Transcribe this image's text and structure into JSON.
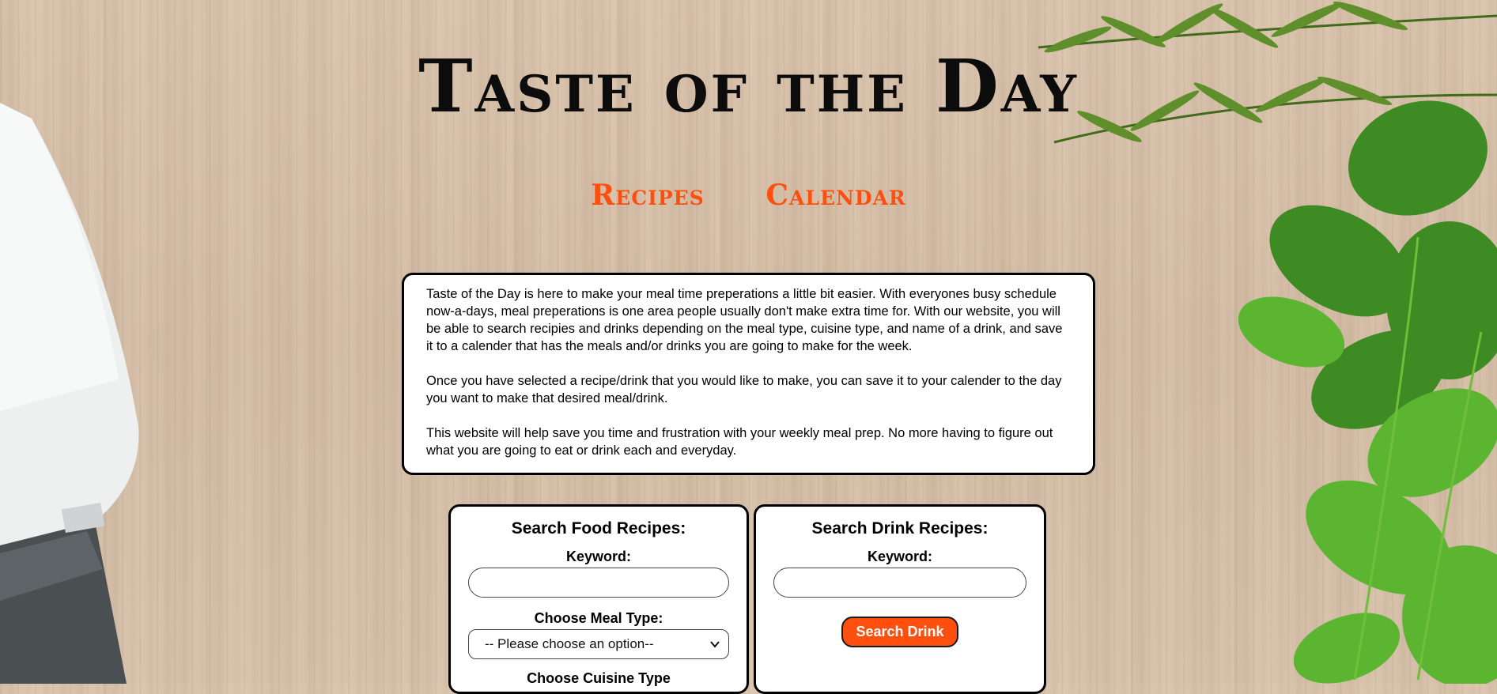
{
  "header": {
    "title": "Taste of the Day"
  },
  "nav": {
    "items": [
      {
        "label": "Recipes"
      },
      {
        "label": "Calendar"
      }
    ]
  },
  "intro": {
    "paragraphs": [
      "Taste of the Day is here to make your meal time preperations a little bit easier. With everyones busy schedule now-a-days, meal preperations is one area people usually don't make extra time for. With our website, you will be able to search recipies and drinks depending on the meal type, cuisine type, and name of a drink, and save it to a calender that has the meals and/or drinks you are going to make for the week.",
      "Once you have selected a recipe/drink that you would like to make, you can save it to your calender to the day you want to make that desired meal/drink.",
      "This website will help save you time and frustration with your weekly meal prep. No more having to figure out what you are going to eat or drink each and everyday."
    ]
  },
  "food_search": {
    "title": "Search Food Recipes:",
    "keyword_label": "Keyword:",
    "keyword_value": "",
    "meal_type_label": "Choose Meal Type:",
    "meal_type_selected": "-- Please choose an option--",
    "cuisine_label_partial": "Choose Cuisine Type"
  },
  "drink_search": {
    "title": "Search Drink Recipes:",
    "keyword_label": "Keyword:",
    "keyword_value": "",
    "button_label": "Search Drink"
  },
  "colors": {
    "accent": "#ff4f0f",
    "text": "#000000",
    "card_bg": "#ffffff"
  },
  "icons": {
    "select_arrow": "chevron-down-icon"
  }
}
